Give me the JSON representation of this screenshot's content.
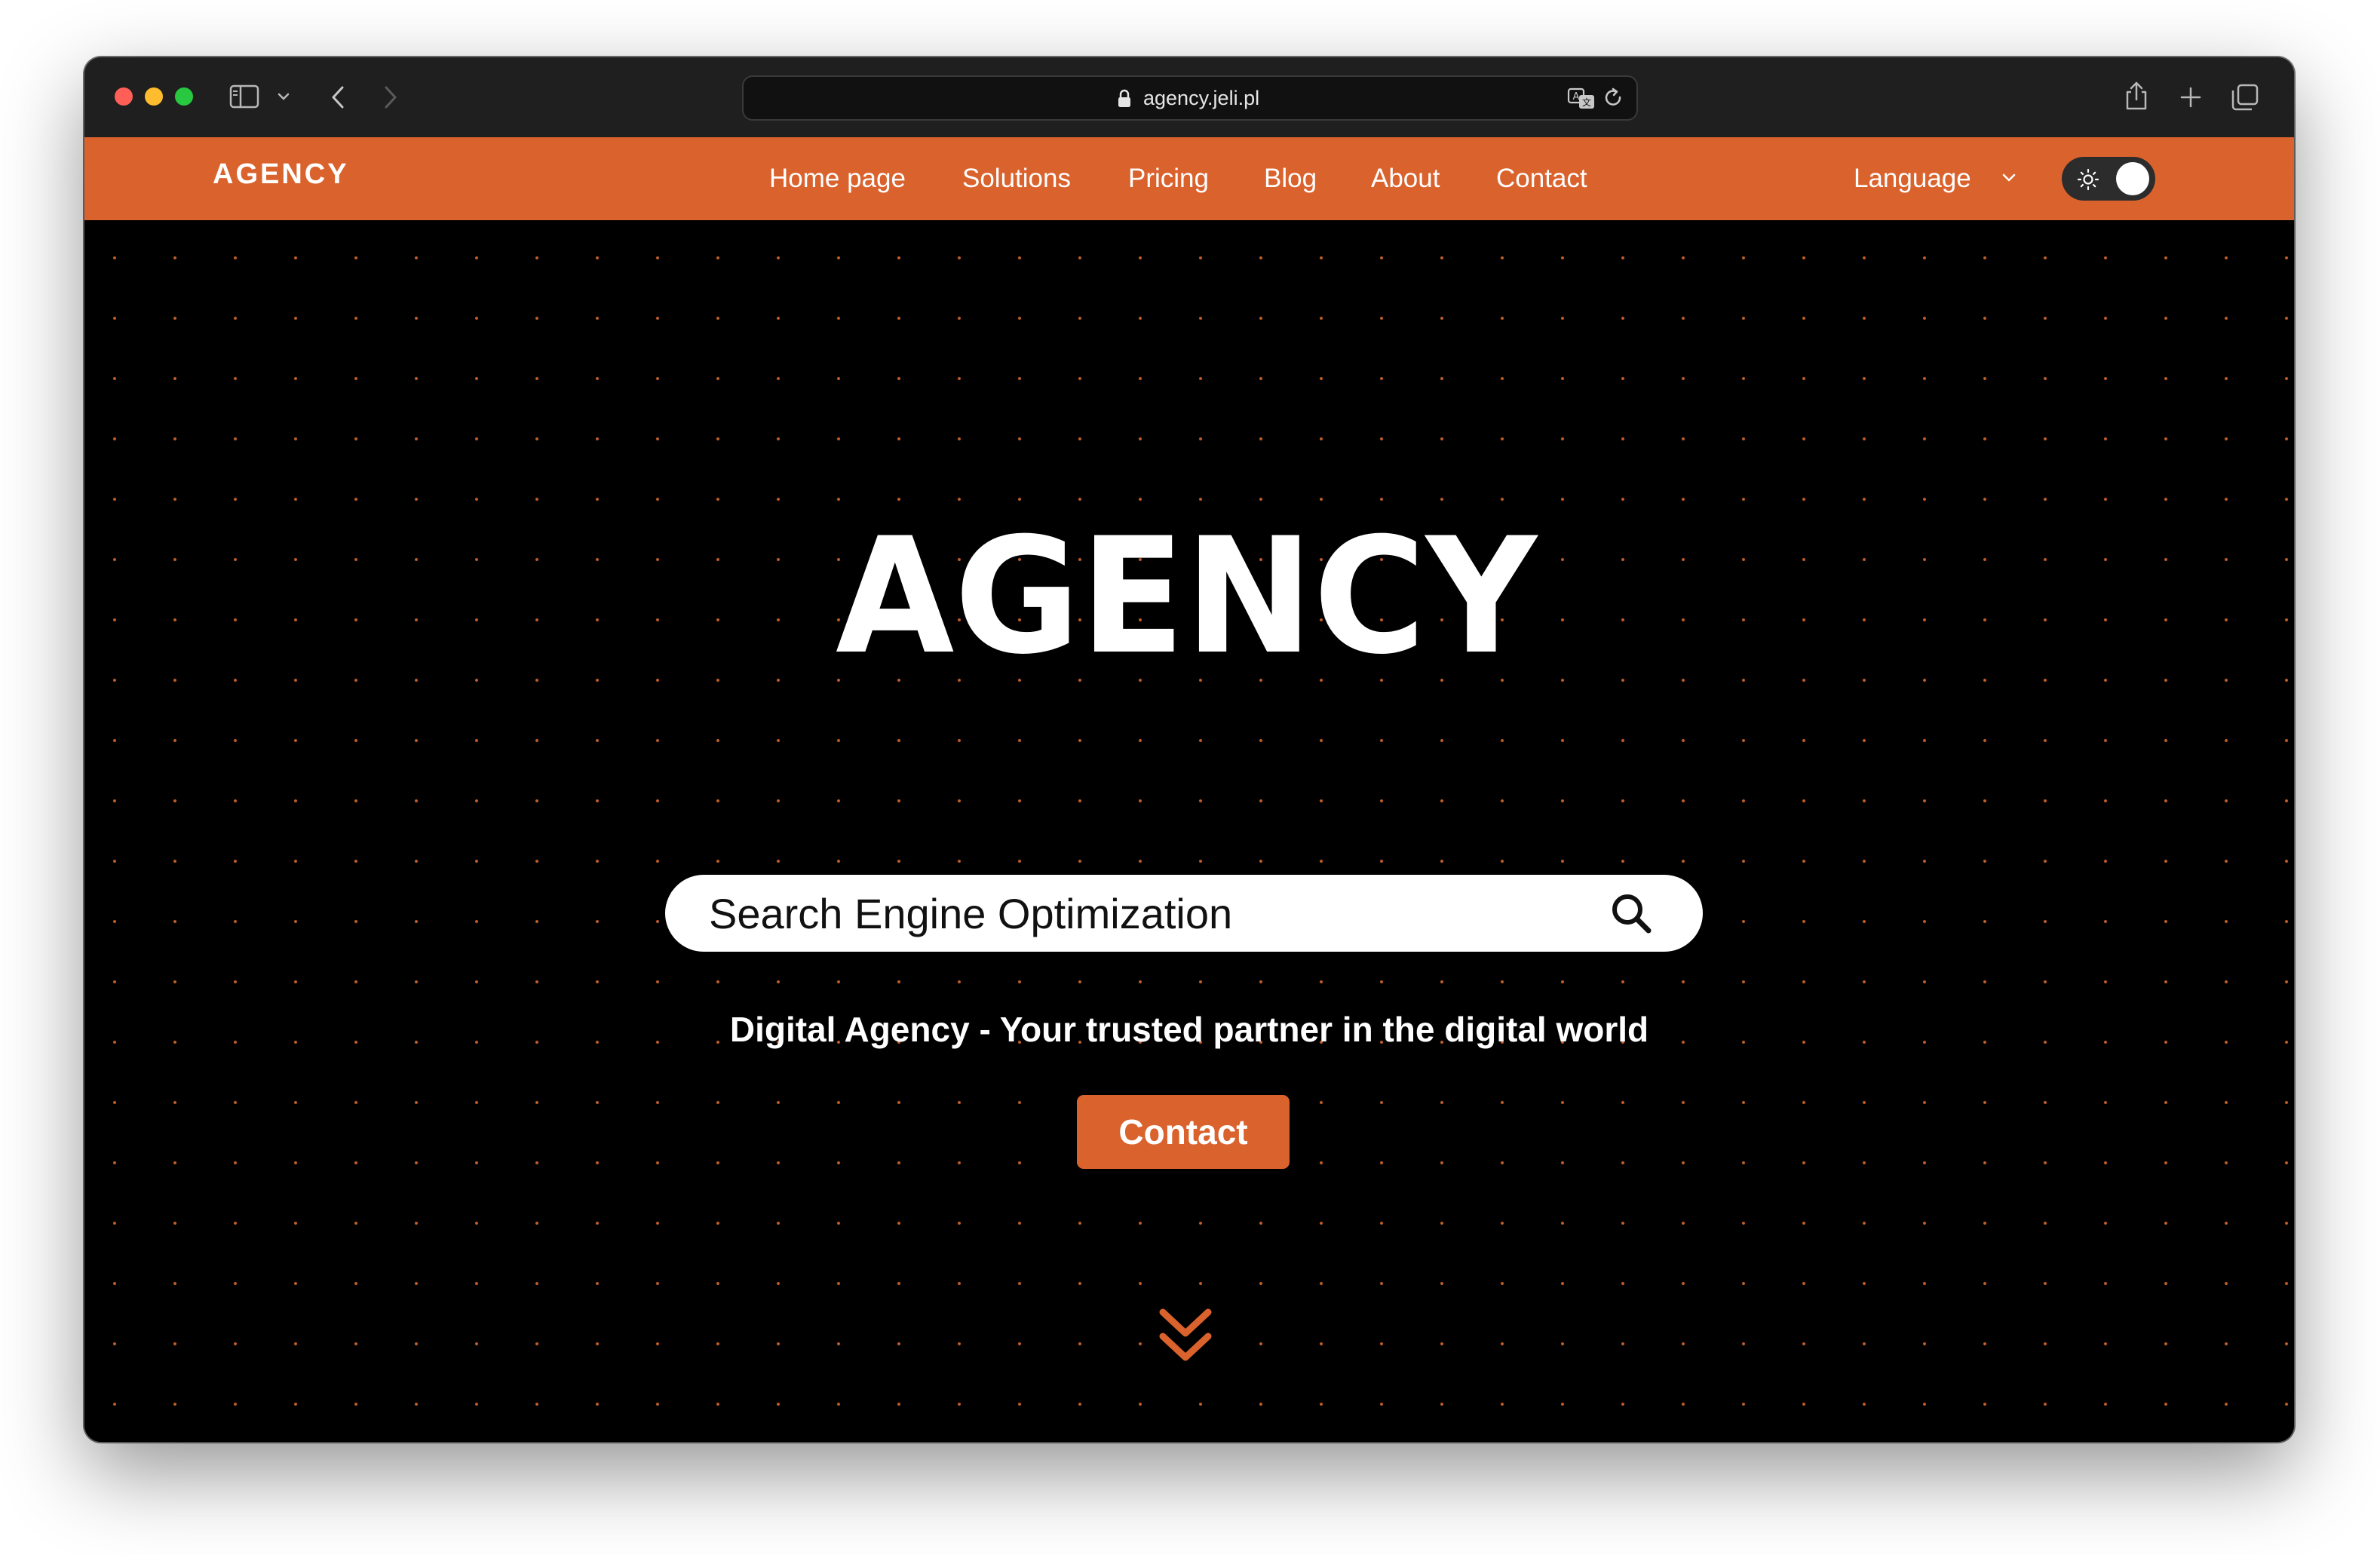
{
  "browser": {
    "url": "agency.jeli.pl",
    "controls": [
      "sidebar-icon",
      "chevron-down-icon",
      "back-icon",
      "forward-icon",
      "translate-icon",
      "reload-icon",
      "share-icon",
      "new-tab-icon",
      "tabs-overview-icon"
    ]
  },
  "nav": {
    "logo": "AGENCY",
    "links": [
      "Home page",
      "Solutions",
      "Pricing",
      "Blog",
      "About",
      "Contact"
    ],
    "language_label": "Language",
    "theme_toggle_icon": "sun-icon"
  },
  "hero": {
    "logo": "AGENCY",
    "search_value": "Search Engine Optimization",
    "tagline": "Digital Agency - Your trusted partner in the digital world",
    "cta_label": "Contact",
    "scroll_icon": "double-chevron-down-icon"
  },
  "colors": {
    "accent": "#d9622d",
    "background": "#000000",
    "dot_pattern": "#c4602a",
    "text": "#ffffff"
  }
}
